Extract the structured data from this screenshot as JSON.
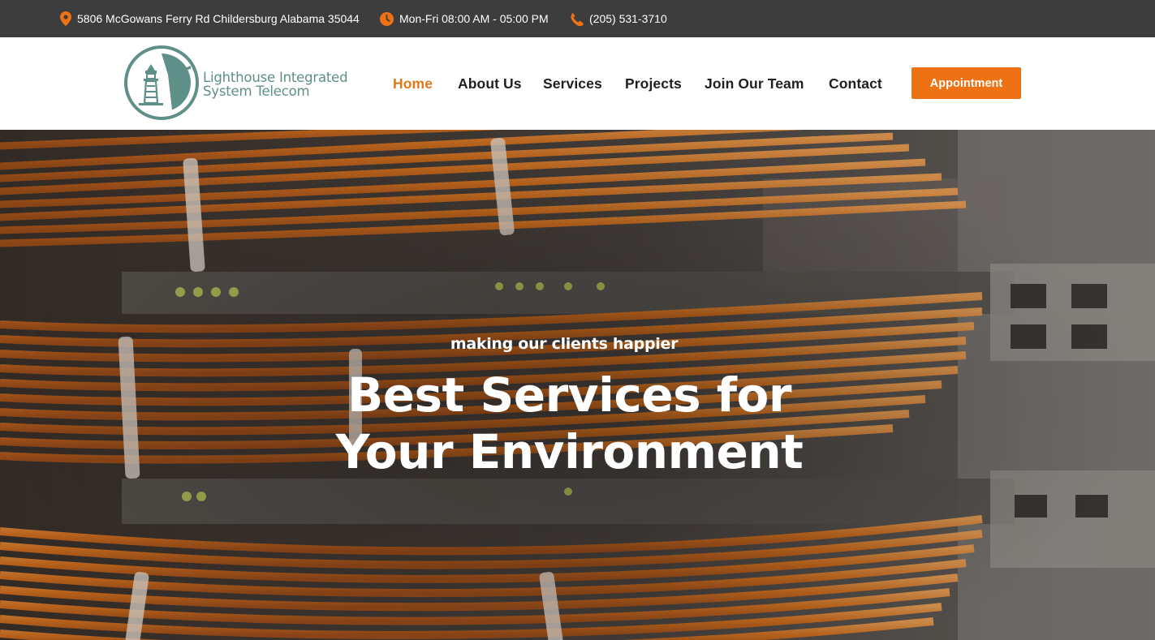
{
  "topbar": {
    "address": "5806 McGowans Ferry Rd Childersburg Alabama 35044",
    "address_icon": "map-pin-icon",
    "hours": "Mon-Fri 08:00 AM - 05:00 PM",
    "hours_icon": "clock-icon",
    "phone": "(205) 531-3710",
    "phone_icon": "phone-icon",
    "icon_color": "#ee7113"
  },
  "logo": {
    "line1": "Lighthouse Integrated",
    "line2": "System Telecom",
    "icon": "lighthouse-logo-icon",
    "color": "#5e8f89"
  },
  "nav": {
    "items": [
      {
        "label": "Home",
        "active": true
      },
      {
        "label": "About Us"
      },
      {
        "label": "Services"
      },
      {
        "label": "Projects"
      },
      {
        "label": "Join Our Team"
      },
      {
        "label": "Contact"
      }
    ],
    "appointment_label": "Appointment",
    "accent_color": "#ee7113"
  },
  "hero": {
    "kicker": "making our clients happier",
    "title_line1": "Best Services for",
    "title_line2": "Your Environment",
    "background": "network-patch-cables-photo"
  }
}
